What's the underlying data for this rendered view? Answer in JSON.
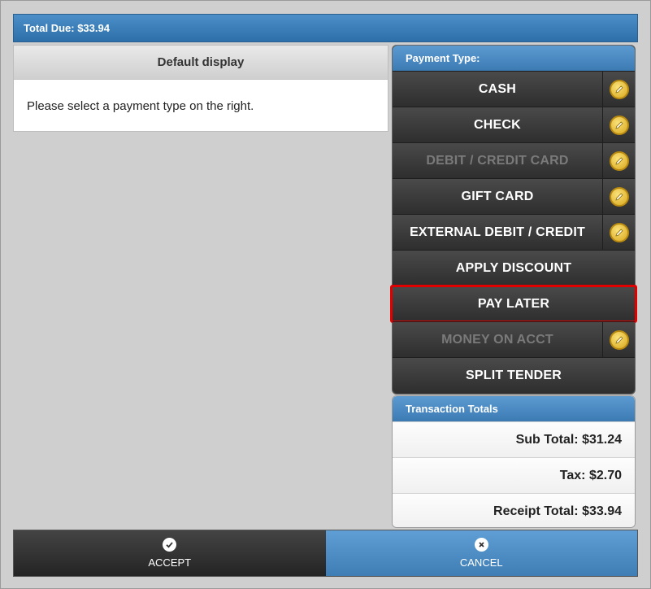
{
  "header": {
    "total_due": "Total Due: $33.94"
  },
  "default_display": {
    "title": "Default display",
    "message": "Please select a payment type on the right."
  },
  "payment": {
    "title": "Payment Type:",
    "options": [
      {
        "label": "CASH",
        "enabled": true,
        "editable": true
      },
      {
        "label": "CHECK",
        "enabled": true,
        "editable": true
      },
      {
        "label": "DEBIT / CREDIT CARD",
        "enabled": false,
        "editable": true
      },
      {
        "label": "GIFT CARD",
        "enabled": true,
        "editable": true
      },
      {
        "label": "EXTERNAL DEBIT / CREDIT",
        "enabled": true,
        "editable": true
      },
      {
        "label": "APPLY DISCOUNT",
        "enabled": true,
        "editable": false
      },
      {
        "label": "PAY LATER",
        "enabled": true,
        "editable": false,
        "highlighted": true
      },
      {
        "label": "MONEY ON ACCT",
        "enabled": false,
        "editable": true
      },
      {
        "label": "SPLIT TENDER",
        "enabled": true,
        "editable": false
      }
    ]
  },
  "totals": {
    "title": "Transaction Totals",
    "sub_total": "Sub Total: $31.24",
    "tax": "Tax: $2.70",
    "receipt_total": "Receipt Total: $33.94"
  },
  "actions": {
    "accept": "ACCEPT",
    "cancel": "CANCEL"
  },
  "colors": {
    "accent_blue": "#3c7ab2",
    "button_dark": "#2e2e2e",
    "edit_icon_gold": "#e8c23a",
    "highlight_red": "#e00000"
  },
  "icons": {
    "edit": "pencil-icon",
    "accept": "check-icon",
    "cancel": "x-icon"
  }
}
